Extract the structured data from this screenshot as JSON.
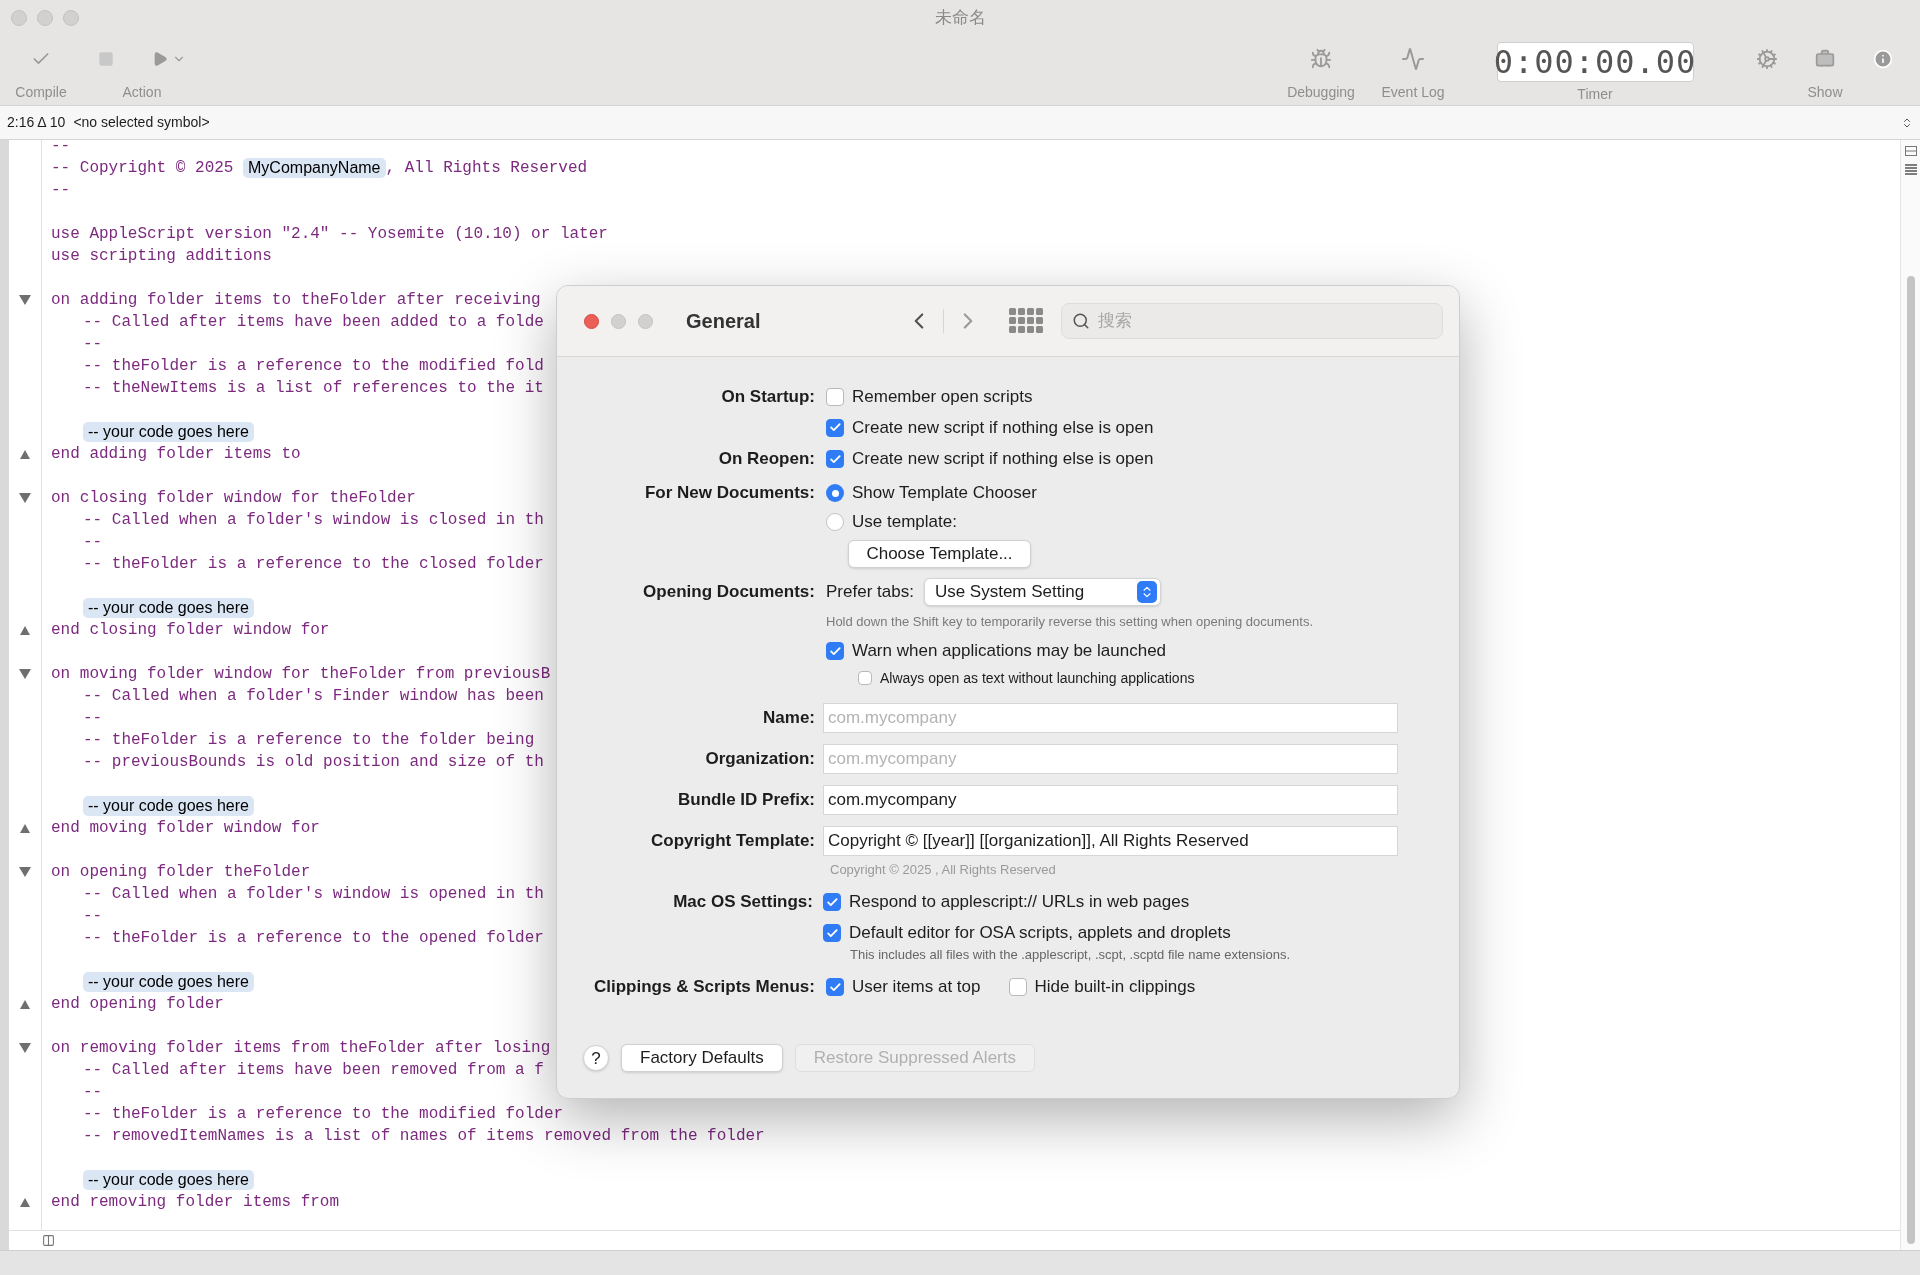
{
  "window": {
    "title": "未命名"
  },
  "toolbar": {
    "compile": {
      "label": "Compile"
    },
    "action": {
      "label": "Action"
    },
    "debugging": {
      "label": "Debugging"
    },
    "event_log": {
      "label": "Event Log"
    },
    "timer": {
      "display": "0:00:00.00",
      "label": "Timer"
    },
    "show": {
      "label": "Show"
    }
  },
  "navigator": {
    "position": "2:16 Δ 10",
    "symbol": "<no selected symbol>"
  },
  "editor": {
    "lines": [
      {
        "kind": "code",
        "text": "--"
      },
      {
        "kind": "copyright",
        "before": "-- Copyright © 2025 ",
        "token": "MyCompanyName",
        "after": ", All Rights Reserved"
      },
      {
        "kind": "code",
        "text": "--"
      },
      {
        "kind": "blank"
      },
      {
        "kind": "code",
        "text": "use AppleScript version \"2.4\" -- Yosemite (10.10) or later"
      },
      {
        "kind": "code",
        "text": "use scripting additions"
      },
      {
        "kind": "blank"
      },
      {
        "kind": "start",
        "text": "on adding folder items to theFolder after receiving"
      },
      {
        "kind": "comment",
        "text": "-- Called after items have been added to a folde"
      },
      {
        "kind": "comment",
        "text": "--"
      },
      {
        "kind": "comment",
        "text": "-- theFolder is a reference to the modified fold"
      },
      {
        "kind": "comment",
        "text": "-- theNewItems is a list of references to the it"
      },
      {
        "kind": "blank"
      },
      {
        "kind": "placeholder",
        "text": "-- your code goes here"
      },
      {
        "kind": "end",
        "text": "end adding folder items to"
      },
      {
        "kind": "blank"
      },
      {
        "kind": "start",
        "text": "on closing folder window for theFolder"
      },
      {
        "kind": "comment",
        "text": "-- Called when a folder's window is closed in th"
      },
      {
        "kind": "comment",
        "text": "--"
      },
      {
        "kind": "comment",
        "text": "-- theFolder is a reference to the closed folder"
      },
      {
        "kind": "blank"
      },
      {
        "kind": "placeholder",
        "text": "-- your code goes here"
      },
      {
        "kind": "end",
        "text": "end closing folder window for"
      },
      {
        "kind": "blank"
      },
      {
        "kind": "start",
        "text": "on moving folder window for theFolder from previousB"
      },
      {
        "kind": "comment",
        "text": "-- Called when a folder's Finder window has been"
      },
      {
        "kind": "comment",
        "text": "--"
      },
      {
        "kind": "comment",
        "text": "-- theFolder is a reference to the folder being"
      },
      {
        "kind": "comment",
        "text": "-- previousBounds is old position and size of th"
      },
      {
        "kind": "blank"
      },
      {
        "kind": "placeholder",
        "text": "-- your code goes here"
      },
      {
        "kind": "end",
        "text": "end moving folder window for"
      },
      {
        "kind": "blank"
      },
      {
        "kind": "start",
        "text": "on opening folder theFolder"
      },
      {
        "kind": "comment",
        "text": "-- Called when a folder's window is opened in th"
      },
      {
        "kind": "comment",
        "text": "--"
      },
      {
        "kind": "comment",
        "text": "-- theFolder is a reference to the opened folder"
      },
      {
        "kind": "blank"
      },
      {
        "kind": "placeholder",
        "text": "-- your code goes here"
      },
      {
        "kind": "end",
        "text": "end opening folder"
      },
      {
        "kind": "blank"
      },
      {
        "kind": "start",
        "text": "on removing folder items from theFolder after losing"
      },
      {
        "kind": "comment",
        "text": "-- Called after items have been removed from a f"
      },
      {
        "kind": "comment",
        "text": "--"
      },
      {
        "kind": "comment",
        "text": "-- theFolder is a reference to the modified folder"
      },
      {
        "kind": "comment",
        "text": "-- removedItemNames is a list of names of items removed from the folder"
      },
      {
        "kind": "blank"
      },
      {
        "kind": "placeholder",
        "text": "-- your code goes here"
      },
      {
        "kind": "end",
        "text": "end removing folder items from"
      }
    ]
  },
  "preferences": {
    "title": "General",
    "search": {
      "placeholder": "搜索"
    },
    "on_startup": {
      "label": "On Startup:",
      "options": [
        {
          "label": "Remember open scripts",
          "checked": false
        },
        {
          "label": "Create new script if nothing else is open",
          "checked": true
        }
      ]
    },
    "on_reopen": {
      "label": "On Reopen:",
      "options": [
        {
          "label": "Create new script if nothing else is open",
          "checked": true
        }
      ]
    },
    "new_documents": {
      "label": "For New Documents:",
      "options": [
        {
          "label": "Show Template Chooser",
          "selected": true
        },
        {
          "label": "Use template:",
          "selected": false
        }
      ],
      "button": "Choose Template..."
    },
    "opening_documents": {
      "label": "Opening Documents:",
      "prefer_tabs_label": "Prefer tabs:",
      "prefer_tabs_value": "Use System Setting",
      "hint": "Hold down the Shift key to temporarily reverse this setting when opening documents.",
      "warn": {
        "label": "Warn when applications may be launched",
        "checked": true
      },
      "always_text": {
        "label": "Always open as text without launching applications",
        "checked": false
      }
    },
    "fields": [
      {
        "label": "Name:",
        "placeholder": "com.mycompany"
      },
      {
        "label": "Organization:",
        "placeholder": "com.mycompany"
      },
      {
        "label": "Bundle ID Prefix:",
        "value": "com.mycompany"
      },
      {
        "label": "Copyright Template:",
        "value": "Copyright © [[year]] [[organization]], All Rights Reserved"
      }
    ],
    "copyright_preview": "Copyright © 2025 , All Rights Reserved",
    "mac_os": {
      "label": "Mac OS Settings:",
      "options": [
        {
          "label": "Respond to applescript:// URLs in web pages",
          "checked": true
        },
        {
          "label": "Default editor for OSA scripts, applets and droplets",
          "checked": true,
          "note": "This includes all files with the .applescript, .scpt, .scptd file name extensions."
        }
      ]
    },
    "clippings": {
      "label": "Clippings & Scripts Menus:",
      "options": [
        {
          "label": "User items at top",
          "checked": true
        },
        {
          "label": "Hide built-in clippings",
          "checked": false
        }
      ]
    },
    "footer": {
      "help": "?",
      "buttons": [
        {
          "label": "Factory Defaults",
          "disabled": false
        },
        {
          "label": "Restore Suppressed Alerts",
          "disabled": true
        }
      ]
    }
  }
}
